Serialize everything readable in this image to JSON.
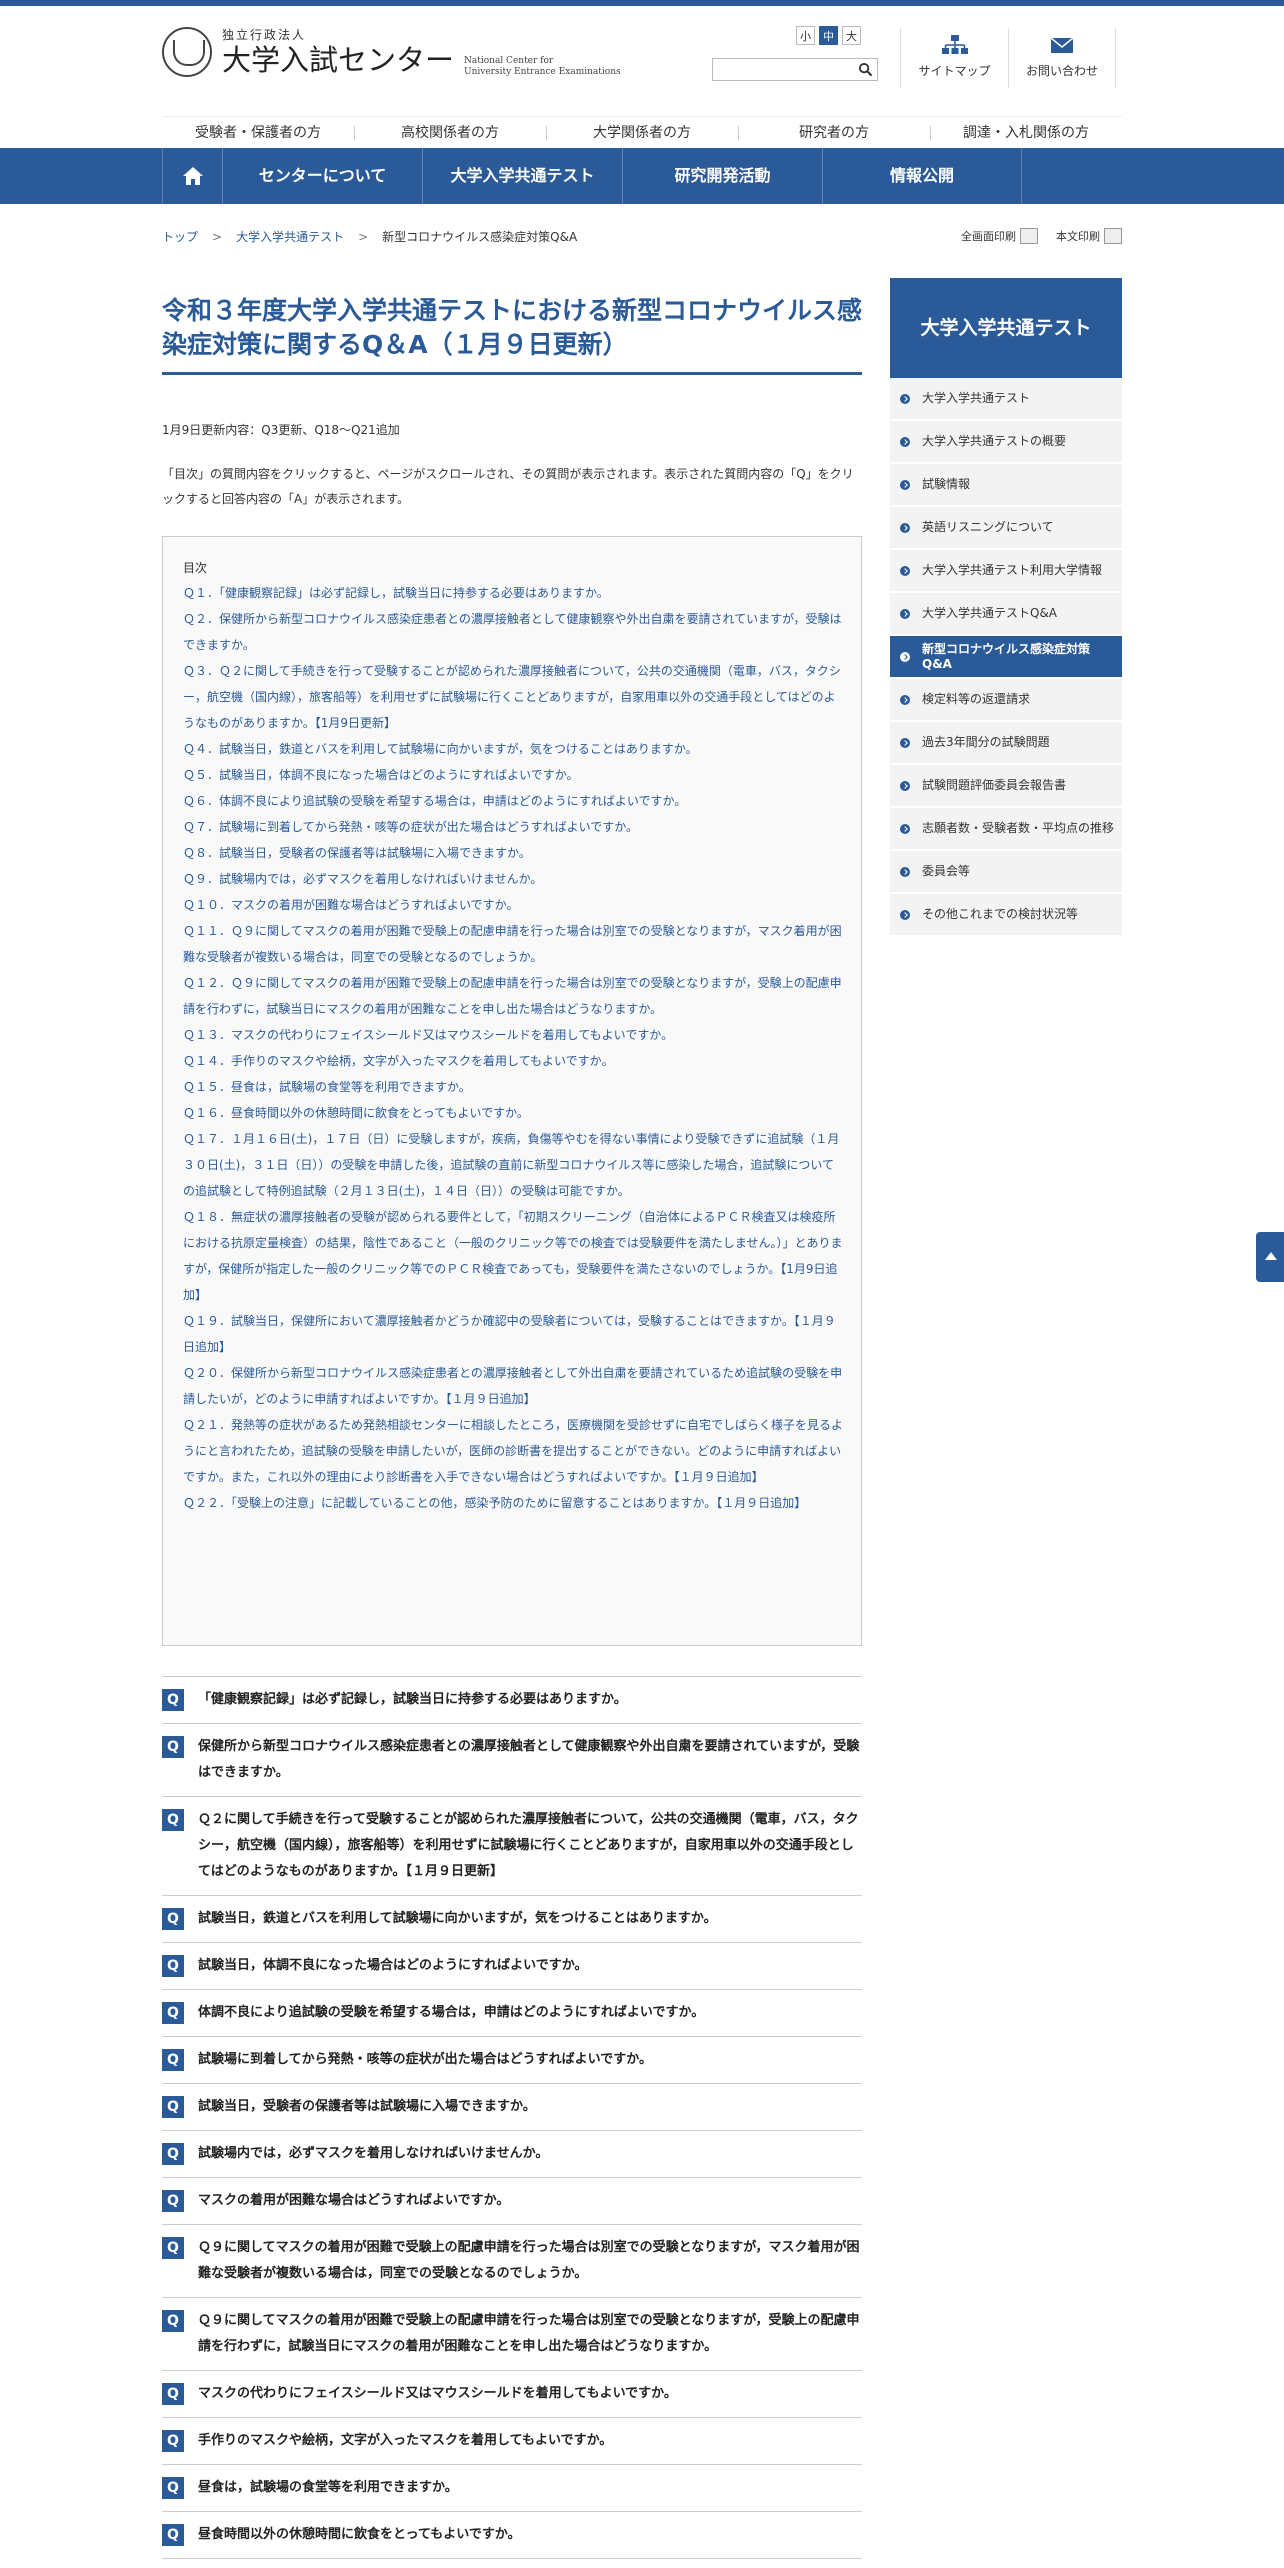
{
  "header": {
    "org_small": "独立行政法人",
    "org_name": "大学入試センター",
    "org_en_1": "National Center for",
    "org_en_2": "University Entrance Examinations",
    "font_sizes": [
      "小",
      "中",
      "大"
    ],
    "search_placeholder": "",
    "sitemap": "サイトマップ",
    "contact": "お問い合わせ"
  },
  "subnav": [
    "受験者・保護者の方",
    "高校関係者の方",
    "大学関係者の方",
    "研究者の方",
    "調達・入札関係の方"
  ],
  "mainnav": [
    "センターについて",
    "大学入学共通テスト",
    "研究開発活動",
    "情報公開"
  ],
  "breadcrumb": {
    "top": "トップ",
    "parent": "大学入学共通テスト",
    "current": "新型コロナウイルス感染症対策Q&A",
    "sep": ">"
  },
  "print": {
    "full": "全画面印刷",
    "body": "本文印刷"
  },
  "page": {
    "title": "令和３年度大学入学共通テストにおける新型コロナウイルス感染症対策に関するQ＆A（１月９日更新）",
    "update_note": "1月9日更新内容：Q3更新、Q18～Q21追加",
    "intro": "「目次」の質問内容をクリックすると、ページがスクロールされ、その質問が表示されます。表示された質問内容の「Q」をクリックすると回答内容の「A」が表示されます。"
  },
  "toc": {
    "title": "目次",
    "items": [
      "Ｑ１．「健康観察記録」は必ず記録し，試験当日に持参する必要はありますか。",
      "Ｑ２．保健所から新型コロナウイルス感染症患者との濃厚接触者として健康観察や外出自粛を要請されていますが，受験はできますか。",
      "Ｑ３．Ｑ２に関して手続きを行って受験することが認められた濃厚接触者について，公共の交通機関（電車，バス，タクシー，航空機（国内線），旅客船等）を利用せずに試験場に行くことどありますが，自家用車以外の交通手段としてはどのようなものがありますか。【1月9日更新】",
      "Ｑ４．試験当日，鉄道とバスを利用して試験場に向かいますが，気をつけることはありますか。",
      "Ｑ５．試験当日，体調不良になった場合はどのようにすればよいですか。",
      "Ｑ６．体調不良により追試験の受験を希望する場合は，申請はどのようにすればよいですか。",
      "Ｑ７．試験場に到着してから発熱・咳等の症状が出た場合はどうすればよいですか。",
      "Ｑ８．試験当日，受験者の保護者等は試験場に入場できますか。",
      "Ｑ９．試験場内では，必ずマスクを着用しなければいけませんか。",
      "Ｑ１０．マスクの着用が困難な場合はどうすればよいですか。",
      "Ｑ１１．Ｑ９に関してマスクの着用が困難で受験上の配慮申請を行った場合は別室での受験となりますが，マスク着用が困難な受験者が複数いる場合は，同室での受験となるのでしょうか。",
      "Ｑ１２．Ｑ９に関してマスクの着用が困難で受験上の配慮申請を行った場合は別室での受験となりますが，受験上の配慮申請を行わずに，試験当日にマスクの着用が困難なことを申し出た場合はどうなりますか。",
      "Ｑ１３．マスクの代わりにフェイスシールド又はマウスシールドを着用してもよいですか。",
      "Ｑ１４．手作りのマスクや絵柄，文字が入ったマスクを着用してもよいですか。",
      "Ｑ１５．昼食は，試験場の食堂等を利用できますか。",
      "Ｑ１６．昼食時間以外の休憩時間に飲食をとってもよいですか。",
      "Ｑ１７．１月１６日(土)，１７日（日）に受験しますが，疾病，負傷等やむを得ない事情により受験できずに追試験（１月３０日(土)，３１日（日））の受験を申請した後，追試験の直前に新型コロナウイルス等に感染した場合，追試験についての追試験として特例追試験（２月１３日(土)，１４日（日））の受験は可能ですか。",
      "Ｑ１８．無症状の濃厚接触者の受験が認められる要件として，「初期スクリーニング（自治体によるＰＣＲ検査又は検疫所における抗原定量検査）の結果，陰性であること（一般のクリニック等での検査では受験要件を満たしません。）」とありますが，保健所が指定した一般のクリニック等でのＰＣＲ検査であっても，受験要件を満たさないのでしょうか。【1月9日追加】",
      "Ｑ１９．試験当日，保健所において濃厚接触者かどうか確認中の受験者については，受験することはできますか。【１月９日追加】",
      "Ｑ２０．保健所から新型コロナウイルス感染症患者との濃厚接触者として外出自粛を要請されているため追試験の受験を申請したいが，どのように申請すればよいですか。【１月９日追加】",
      "Ｑ２１．発熱等の症状があるため発熱相談センターに相談したところ，医療機関を受診せずに自宅でしばらく様子を見るようにと言われたため，追試験の受験を申請したいが，医師の診断書を提出することができない。どのように申請すればよいですか。また，これ以外の理由により診断書を入手できない場合はどうすればよいですか。【１月９日追加】",
      "Ｑ２２．「受験上の注意」に記載していることの他，感染予防のために留意することはありますか。【１月９日追加】"
    ]
  },
  "q_mark": "Q",
  "questions": [
    "「健康観察記録」は必ず記録し，試験当日に持参する必要はありますか。",
    "保健所から新型コロナウイルス感染症患者との濃厚接触者として健康観察や外出自粛を要請されていますが，受験はできますか。",
    "Ｑ２に関して手続きを行って受験することが認められた濃厚接触者について，公共の交通機関（電車，バス，タクシー，航空機（国内線），旅客船等）を利用せずに試験場に行くことどありますが，自家用車以外の交通手段としてはどのようなものがありますか。【１月９日更新】",
    "試験当日，鉄道とバスを利用して試験場に向かいますが，気をつけることはありますか。",
    "試験当日，体調不良になった場合はどのようにすればよいですか。",
    "体調不良により追試験の受験を希望する場合は，申請はどのようにすればよいですか。",
    "試験場に到着してから発熱・咳等の症状が出た場合はどうすればよいですか。",
    "試験当日，受験者の保護者等は試験場に入場できますか。",
    "試験場内では，必ずマスクを着用しなければいけませんか。",
    "マスクの着用が困難な場合はどうすればよいですか。",
    "Ｑ９に関してマスクの着用が困難で受験上の配慮申請を行った場合は別室での受験となりますが，マスク着用が困難な受験者が複数いる場合は，同室での受験となるのでしょうか。",
    "Ｑ９に関してマスクの着用が困難で受験上の配慮申請を行った場合は別室での受験となりますが，受験上の配慮申請を行わずに，試験当日にマスクの着用が困難なことを申し出た場合はどうなりますか。",
    "マスクの代わりにフェイスシールド又はマウスシールドを着用してもよいですか。",
    "手作りのマスクや絵柄，文字が入ったマスクを着用してもよいですか。",
    "昼食は，試験場の食堂等を利用できますか。",
    "昼食時間以外の休憩時間に飲食をとってもよいですか。"
  ],
  "sidebar": {
    "title": "大学入学共通テスト",
    "items": [
      "大学入学共通テスト",
      "大学入学共通テストの概要",
      "試験情報",
      "英語リスニングについて",
      "大学入学共通テスト利用大学情報",
      "大学入学共通テストQ&A",
      "新型コロナウイルス感染症対策Q&A",
      "検定料等の返還請求",
      "過去3年間分の試験問題",
      "試験問題評価委員会報告書",
      "志願者数・受験者数・平均点の推移",
      "委員会等",
      "その他これまでの検討状況等"
    ],
    "active_index": 6
  },
  "colors": {
    "brand": "#2a5a98"
  }
}
